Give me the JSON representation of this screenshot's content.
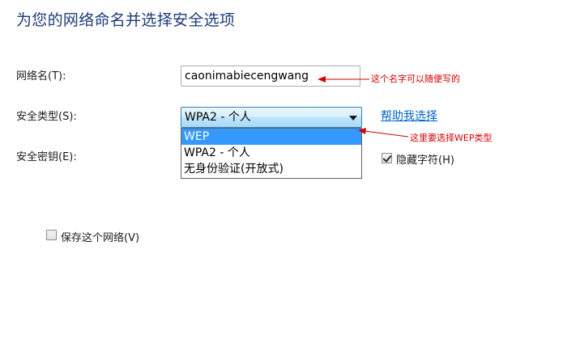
{
  "page": {
    "title": "为您的网络命名并选择安全选项"
  },
  "form": {
    "network_name_label": "网络名(T):",
    "network_name_value": "caonimabiecengwang",
    "security_type_label": "安全类型(S):",
    "security_type_value": "WPA2 - 个人",
    "security_key_label": "安全密钥(E):",
    "help_link": "帮助我选择",
    "hide_chars_label": "隐藏字符(H)",
    "hide_chars_checked": true,
    "save_network_label": "保存这个网络(V)",
    "save_network_checked": false
  },
  "dropdown": {
    "options": [
      "WEP",
      "WPA2 - 个人",
      "无身份验证(开放式)"
    ],
    "highlighted": "WEP"
  },
  "annotations": {
    "name_note": "这个名字可以随便写的",
    "type_note": "这里要选择WEP类型",
    "color": "#d40000"
  },
  "colors": {
    "title": "#1e3a78",
    "link": "#0066cc",
    "highlight": "#3399ff"
  }
}
